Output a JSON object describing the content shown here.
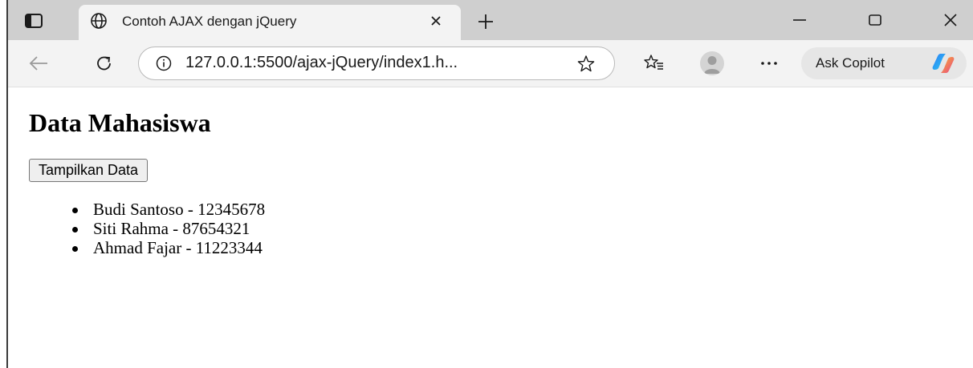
{
  "browser": {
    "tab": {
      "title": "Contoh AJAX dengan jQuery",
      "favicon_icon": "globe-icon",
      "close_icon": "close-icon"
    },
    "new_tab_icon": "plus-icon",
    "window_controls": [
      "minimize-icon",
      "maximize-icon",
      "close-icon"
    ],
    "toolbar": {
      "back_icon": "back-arrow-icon",
      "refresh_icon": "refresh-icon",
      "address": {
        "info_icon": "info-icon",
        "url": "127.0.0.1:5500/ajax-jQuery/index1.h...",
        "favorite_icon": "star-icon"
      },
      "favorites_icon": "favorites-list-icon",
      "profile_icon": "avatar",
      "more_icon": "more-icon",
      "copilot_label": "Ask Copilot",
      "copilot_icon": "copilot-icon"
    }
  },
  "page": {
    "title": "Data Mahasiswa",
    "button_label": "Tampilkan Data",
    "items": [
      "Budi Santoso - 12345678",
      "Siti Rahma - 87654321",
      "Ahmad Fajar - 11223344"
    ]
  }
}
